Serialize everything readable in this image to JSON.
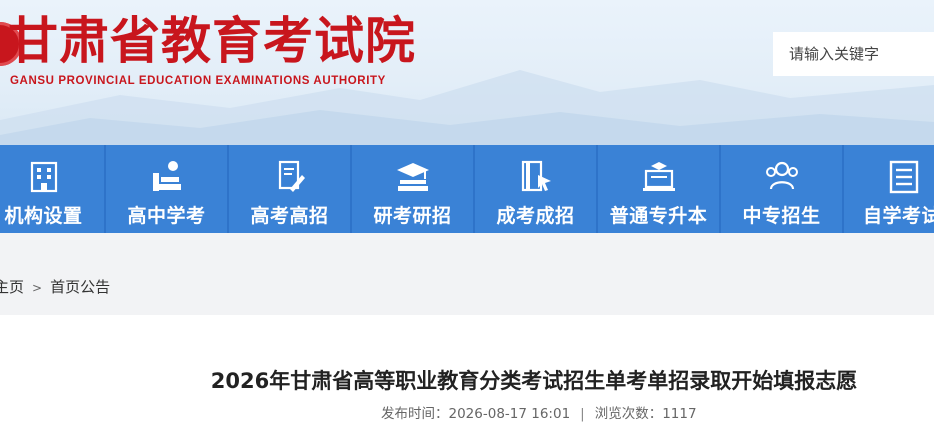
{
  "header": {
    "title": "甘肃省教育考试院",
    "subtitle": "GANSU PROVINCIAL EDUCATION EXAMINATIONS AUTHORITY",
    "search_placeholder": "请输入关键字",
    "brand_color": "#c8161d"
  },
  "nav": {
    "background": "#3a82d6",
    "items": [
      {
        "label": "机构设置",
        "icon": "building-icon"
      },
      {
        "label": "高中学考",
        "icon": "books-apple-icon"
      },
      {
        "label": "高考高招",
        "icon": "document-pen-icon"
      },
      {
        "label": "研考研招",
        "icon": "graduation-cap-books-icon"
      },
      {
        "label": "成考成招",
        "icon": "book-cursor-icon"
      },
      {
        "label": "普通专升本",
        "icon": "laptop-cap-icon"
      },
      {
        "label": "中专招生",
        "icon": "people-icon"
      },
      {
        "label": "自学考试",
        "icon": "list-document-icon"
      }
    ]
  },
  "breadcrumb": {
    "home": "主页",
    "separator": ">",
    "current": "首页公告"
  },
  "article": {
    "title": "2026年甘肃省高等职业教育分类考试招生单考单招录取开始填报志愿",
    "publish_label": "发布时间：",
    "publish_time": "2026-08-17 16:01",
    "separator": "|",
    "views_label": "浏览次数：",
    "views": "1117"
  }
}
